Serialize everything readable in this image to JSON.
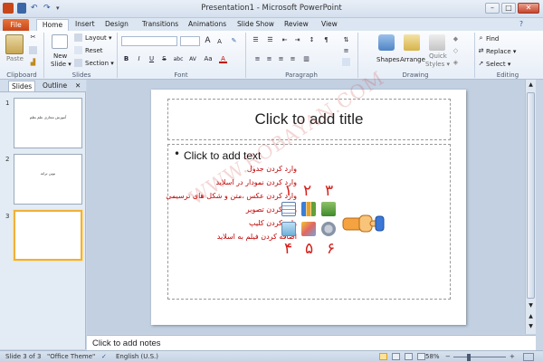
{
  "window": {
    "title": "Presentation1 - Microsoft PowerPoint",
    "minimize": "–",
    "maximize": "□",
    "close": "✕"
  },
  "ribbon_tabs": [
    "File",
    "Home",
    "Insert",
    "Design",
    "Transitions",
    "Animations",
    "Slide Show",
    "Review",
    "View"
  ],
  "ribbon": {
    "clipboard": {
      "paste": "Paste",
      "label": "Clipboard"
    },
    "slides": {
      "new_slide": "New",
      "new_slide_2": "Slide ▾",
      "layout": "Layout ▾",
      "reset": "Reset",
      "section": "Section ▾",
      "label": "Slides"
    },
    "font": {
      "label": "Font",
      "font_name": "",
      "font_size": "",
      "bold": "B",
      "italic": "I",
      "underline": "U",
      "strike": "S",
      "shadow": "abc",
      "spacing": "AV",
      "case": "Aa",
      "color": "A",
      "grow": "A",
      "shrink": "A"
    },
    "paragraph": {
      "label": "Paragraph"
    },
    "drawing": {
      "shapes": "Shapes",
      "arrange": "Arrange",
      "quick_styles": "Quick",
      "quick_styles_2": "Styles ▾",
      "label": "Drawing"
    },
    "editing": {
      "find": "Find",
      "replace": "Replace ▾",
      "select": "Select ▾",
      "label": "Editing"
    }
  },
  "left_pane": {
    "tabs": [
      "Slides",
      "Outline"
    ],
    "close": "✕",
    "thumbnails": [
      {
        "num": "1",
        "text": "آموزش مجازی علم نظم"
      },
      {
        "num": "2",
        "text": "نوین ترانه"
      },
      {
        "num": "3",
        "text": ""
      }
    ]
  },
  "slide": {
    "title_placeholder": "Click to add title",
    "body_placeholder": "Click to add text",
    "bullet": "•",
    "persian_lines": [
      "وارد کردن جدول",
      "وارد کردن نمودار در اسلاید",
      "وارد کردن عکس ،متن و شکل های ترسیمی",
      "وارد کردن تصویر",
      "وارد کردن کلیپ",
      "اضافه کردن فیلم به اسلاید"
    ],
    "numbers_top": [
      "١",
      "٢",
      "٣"
    ],
    "numbers_bottom": [
      "۴",
      "۵",
      "۶"
    ],
    "watermark": "WWW.ROBAYAN.COM"
  },
  "notes": {
    "placeholder": "Click to add notes"
  },
  "status_bar": {
    "slide_info": "Slide 3 of 3",
    "theme": "\"Office Theme\"",
    "language": "English (U.S.)",
    "zoom": "58%",
    "zoom_minus": "−",
    "zoom_plus": "+"
  }
}
